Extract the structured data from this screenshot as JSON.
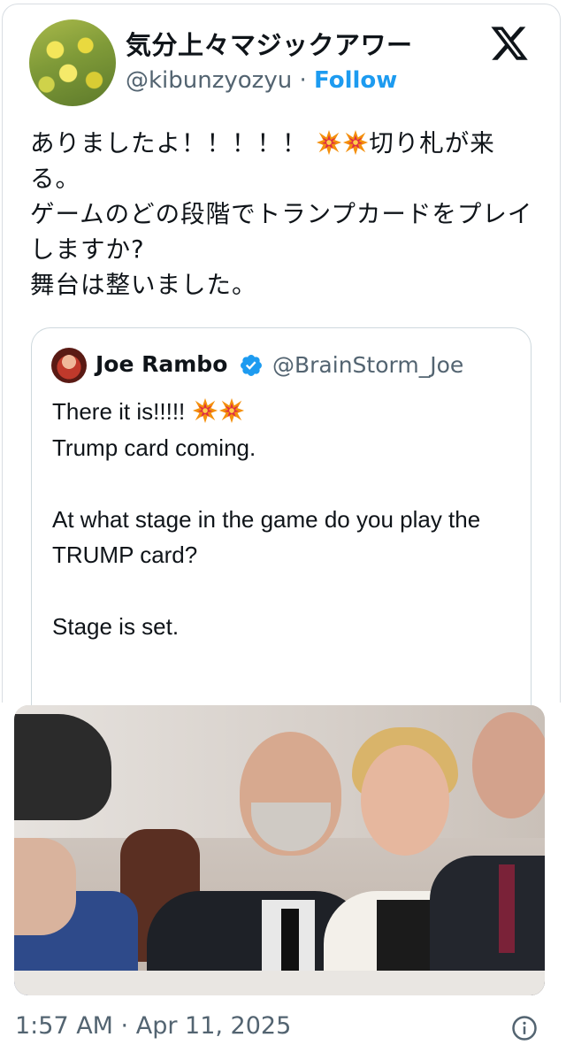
{
  "tweet": {
    "display_name": "気分上々マジックアワー",
    "handle": "@kibunzyozyu",
    "separator": " · ",
    "follow_label": "Follow",
    "text_part1": "ありましたよ！！！！！ ",
    "text_part2": "切り札が来る。\nゲームのどの段階でトランプカードをプレイしますか?\n舞台は整いました。",
    "timestamp": "1:57 AM · Apr 11, 2025"
  },
  "quote": {
    "name": "Joe Rambo",
    "handle": "@BrainStorm_Joe",
    "line1": "There it is!!!!! ",
    "text_rest": "\nTrump card coming.\n\nAt what stage in the game do you play the TRUMP card?\n\nStage is set."
  },
  "icons": {
    "brand": "x-logo-icon",
    "burst": "collision-emoji-icon",
    "verified": "verified-badge-icon",
    "info": "info-icon"
  },
  "colors": {
    "accent": "#1d9bf0",
    "muted": "#536471",
    "text": "#0f1419"
  }
}
